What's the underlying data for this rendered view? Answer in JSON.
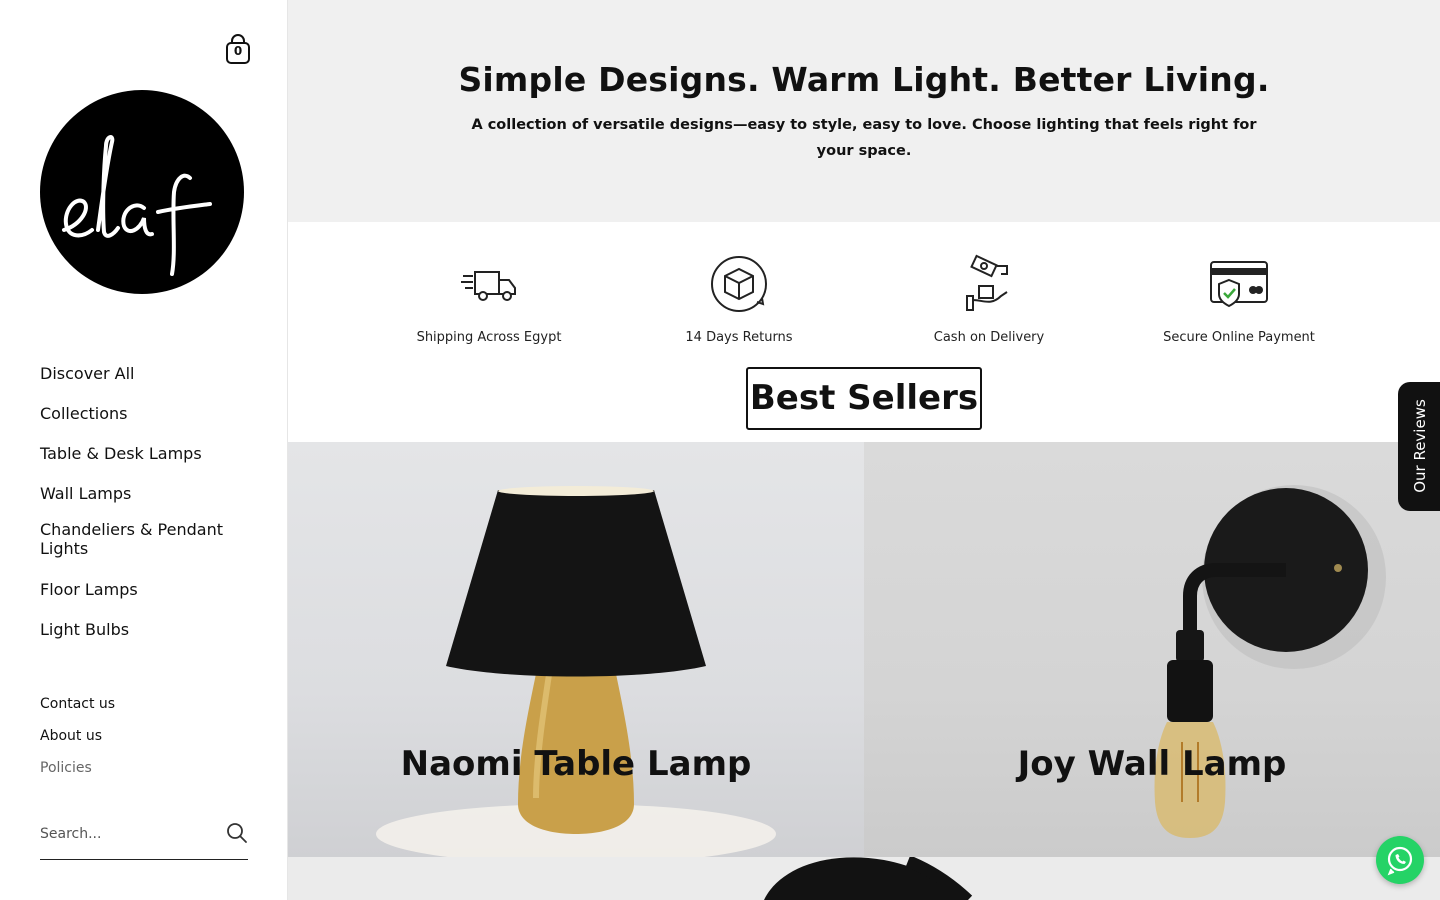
{
  "sidebar": {
    "cart_count": "0",
    "logo_text": "elaf",
    "nav": [
      {
        "label": "Discover All"
      },
      {
        "label": "Collections"
      },
      {
        "label": "Table & Desk Lamps"
      },
      {
        "label": "Wall Lamps"
      },
      {
        "label": "Chandeliers & Pendant Lights"
      },
      {
        "label": "Floor Lamps"
      },
      {
        "label": "Light Bulbs"
      }
    ],
    "subnav": [
      {
        "label": "Contact us"
      },
      {
        "label": "About us"
      },
      {
        "label": "Policies"
      }
    ],
    "search": {
      "placeholder": "Search..."
    }
  },
  "hero": {
    "title": "Simple Designs. Warm Light. Better Living.",
    "subtitle": "A collection of versatile designs—easy to style, easy to love. Choose lighting that feels right for your space."
  },
  "features": [
    {
      "label": "Shipping Across Egypt",
      "icon": "delivery-truck-icon"
    },
    {
      "label": "14 Days Returns",
      "icon": "return-box-icon"
    },
    {
      "label": "Cash on Delivery",
      "icon": "cash-hand-icon"
    },
    {
      "label": "Secure Online Payment",
      "icon": "secure-card-icon"
    }
  ],
  "best_sellers_label": "Best Sellers",
  "products": [
    {
      "name": "Naomi Table Lamp"
    },
    {
      "name": "Joy Wall Lamp"
    }
  ],
  "reviews_tab": "Our Reviews",
  "colors": {
    "accent": "#111111",
    "hero_bg": "#f0f0f0",
    "whatsapp": "#25d366"
  }
}
